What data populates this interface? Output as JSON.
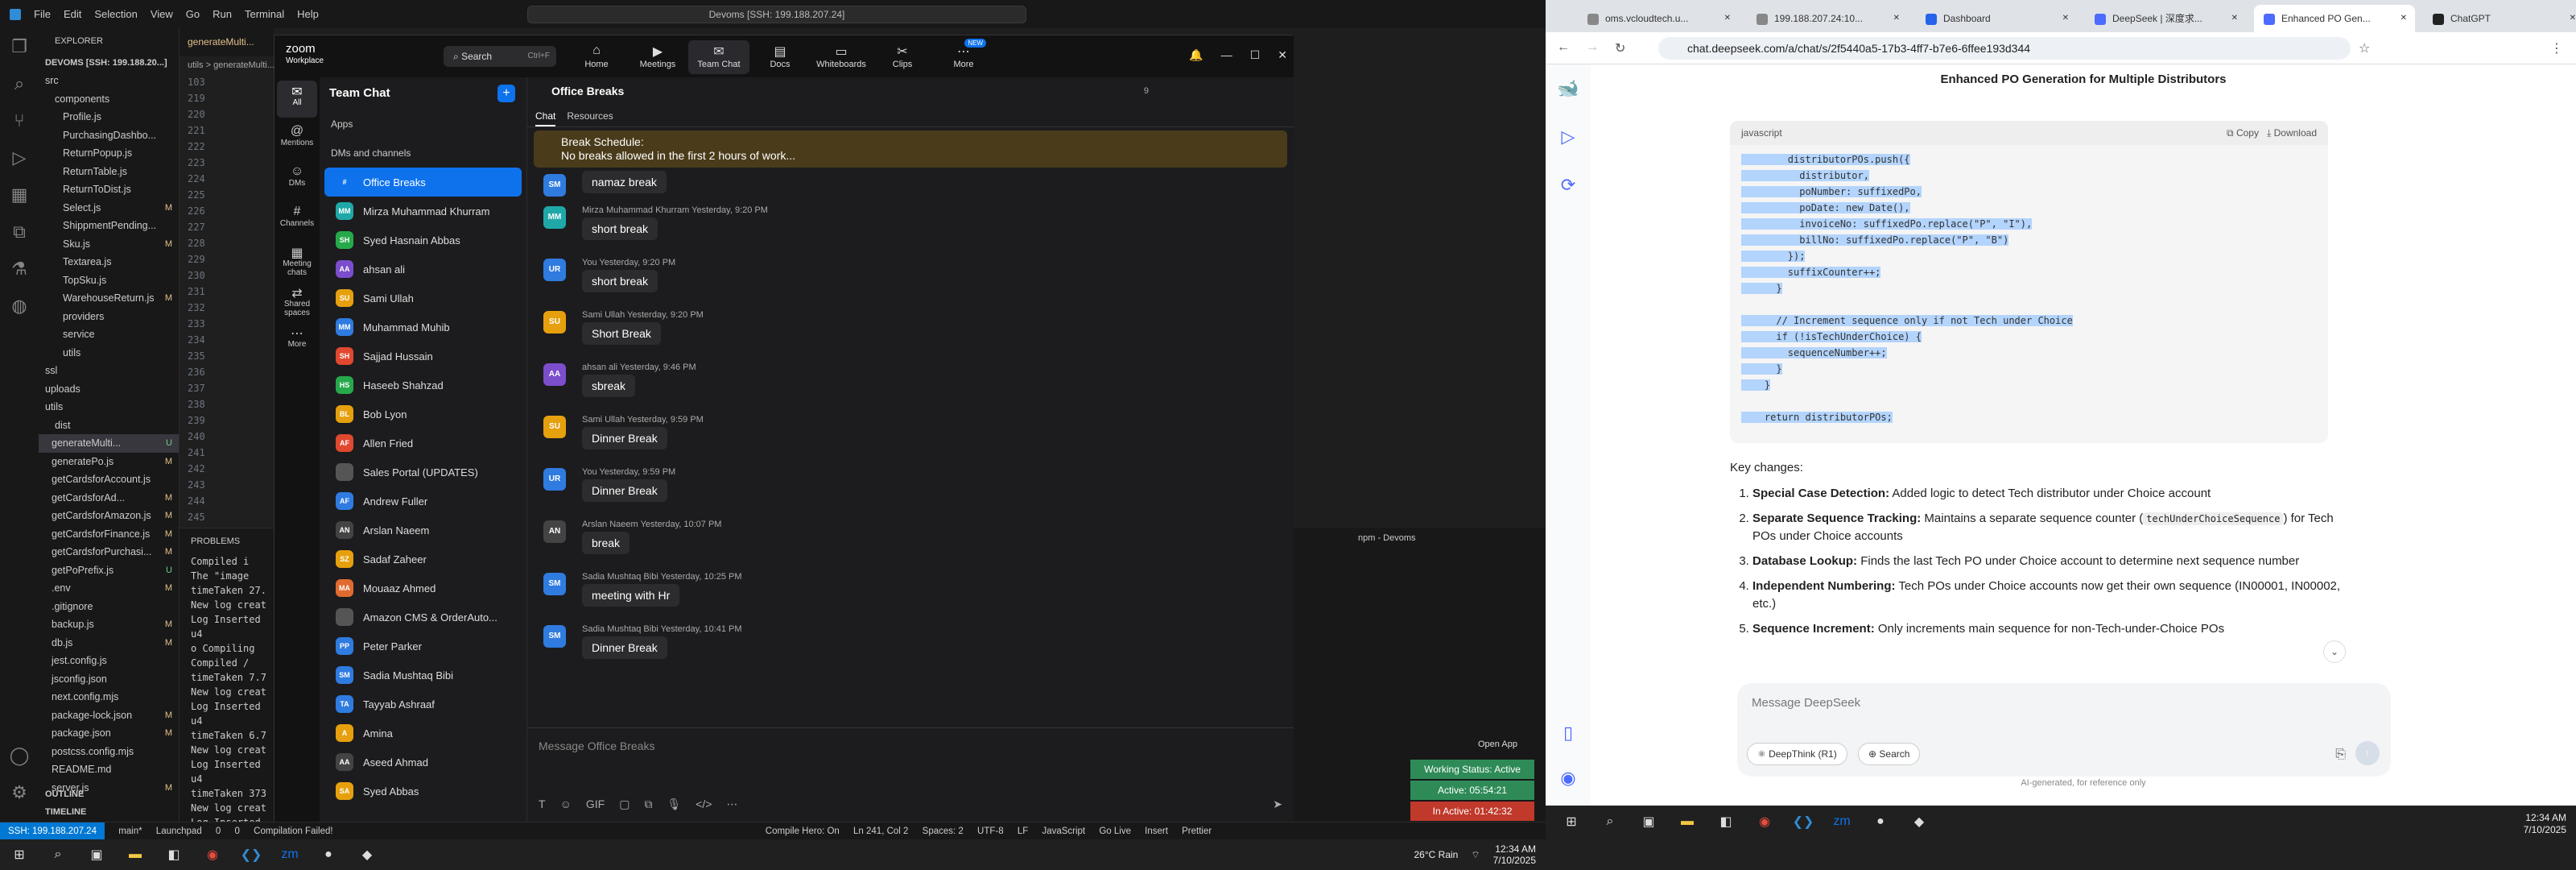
{
  "vscode": {
    "menu": [
      "File",
      "Edit",
      "Selection",
      "View",
      "Go",
      "Run",
      "Terminal",
      "Help"
    ],
    "command_center": "Devoms [SSH: 199.188.207.24]",
    "explorer_title": "EXPLORER",
    "workspace": "DEVOMS [SSH: 199.188.20...]",
    "tab": "generateMulti...",
    "breadcrumb": "utils > generateMulti...",
    "files": [
      {
        "name": "src",
        "s": ""
      },
      {
        "name": "components",
        "s": ""
      },
      {
        "name": "Profile.js",
        "s": ""
      },
      {
        "name": "PurchasingDashbo...",
        "s": ""
      },
      {
        "name": "ReturnPopup.js",
        "s": ""
      },
      {
        "name": "ReturnTable.js",
        "s": ""
      },
      {
        "name": "ReturnToDist.js",
        "s": ""
      },
      {
        "name": "Select.js",
        "s": "M"
      },
      {
        "name": "ShippmentPending...",
        "s": ""
      },
      {
        "name": "Sku.js",
        "s": "M"
      },
      {
        "name": "Textarea.js",
        "s": ""
      },
      {
        "name": "TopSku.js",
        "s": ""
      },
      {
        "name": "WarehouseReturn.js",
        "s": "M"
      },
      {
        "name": "providers",
        "s": ""
      },
      {
        "name": "service",
        "s": ""
      },
      {
        "name": "utils",
        "s": ""
      },
      {
        "name": "ssl",
        "s": ""
      },
      {
        "name": "uploads",
        "s": ""
      },
      {
        "name": "utils",
        "s": ""
      },
      {
        "name": "dist",
        "s": ""
      },
      {
        "name": "generateMulti...",
        "s": "U"
      },
      {
        "name": "generatePo.js",
        "s": "M"
      },
      {
        "name": "getCardsforAccount.js",
        "s": ""
      },
      {
        "name": "getCardsforAd...",
        "s": "M"
      },
      {
        "name": "getCardsforAmazon.js",
        "s": "M"
      },
      {
        "name": "getCardsforFinance.js",
        "s": "M"
      },
      {
        "name": "getCardsforPurchasi...",
        "s": "M"
      },
      {
        "name": "getPoPrefix.js",
        "s": "U"
      },
      {
        "name": ".env",
        "s": "M"
      },
      {
        "name": ".gitignore",
        "s": ""
      },
      {
        "name": "backup.js",
        "s": "M"
      },
      {
        "name": "db.js",
        "s": "M"
      },
      {
        "name": "jest.config.js",
        "s": ""
      },
      {
        "name": "jsconfig.json",
        "s": ""
      },
      {
        "name": "next.config.mjs",
        "s": ""
      },
      {
        "name": "package-lock.json",
        "s": "M"
      },
      {
        "name": "package.json",
        "s": "M"
      },
      {
        "name": "postcss.config.mjs",
        "s": ""
      },
      {
        "name": "README.md",
        "s": ""
      },
      {
        "name": "server.js",
        "s": "M"
      }
    ],
    "outline": "OUTLINE",
    "timeline": "TIMELINE",
    "line_numbers": [
      "103",
      "219",
      "220",
      "221",
      "222",
      "223",
      "224",
      "225",
      "226",
      "227",
      "228",
      "229",
      "230",
      "231",
      "232",
      "233",
      "234",
      "235",
      "236",
      "237",
      "238",
      "239",
      "240",
      "241",
      "242",
      "243",
      "244",
      "245"
    ],
    "problems": "PROBLEMS",
    "terminal_lines": [
      "Compiled i",
      "The \"image",
      "timeTaken 27.",
      "New log creat",
      "Log Inserted",
      "u4",
      "o Compiling",
      "Compiled /",
      "timeTaken 7.7",
      "New log creat",
      "Log Inserted",
      "u4",
      "timeTaken 6.7",
      "New log creat",
      "Log Inserted",
      "u4",
      "timeTaken 373",
      "New log creat",
      "Log Inserted"
    ],
    "term_title": "npm - Devoms",
    "status": {
      "remote": "SSH: 199.188.207.24",
      "branch": "main*",
      "launchpad": "Launchpad",
      "errors": "0",
      "warnings": "0",
      "compile": "Compilation Failed!",
      "hero": "Compile Hero: On",
      "pos": "Ln 241, Col 2",
      "spaces": "Spaces: 2",
      "enc": "UTF-8",
      "eol": "LF",
      "lang": "JavaScript",
      "golive": "Go Live",
      "insert": "Insert",
      "prettier": "Prettier"
    },
    "weather": "26°C Rain",
    "time": "12:34 AM",
    "date": "7/10/2025"
  },
  "zoom": {
    "brand": "zoom",
    "product": "Workplace",
    "search": "Search",
    "search_hint": "Ctrl+F",
    "nav": [
      {
        "label": "Home",
        "icon": "home-icon"
      },
      {
        "label": "Meetings",
        "icon": "video-icon"
      },
      {
        "label": "Team Chat",
        "icon": "chat-icon"
      },
      {
        "label": "Docs",
        "icon": "doc-icon"
      },
      {
        "label": "Whiteboards",
        "icon": "whiteboard-icon"
      },
      {
        "label": "Clips",
        "icon": "clips-icon"
      },
      {
        "label": "More",
        "icon": "more-icon"
      }
    ],
    "new_badge": "NEW",
    "rail": [
      {
        "label": "All",
        "icon": "chat-icon"
      },
      {
        "label": "Mentions",
        "icon": "at-icon"
      },
      {
        "label": "DMs",
        "icon": "person-icon"
      },
      {
        "label": "Channels",
        "icon": "hash-icon"
      },
      {
        "label": "Meeting chats",
        "icon": "calendar-icon"
      },
      {
        "label": "Shared spaces",
        "icon": "share-icon"
      },
      {
        "label": "More",
        "icon": "more-icon"
      }
    ],
    "panel_title": "Team Chat",
    "apps": "Apps",
    "dms_header": "DMs and channels",
    "contacts": [
      {
        "name": "Office Breaks",
        "init": "",
        "color": "#0e72ed"
      },
      {
        "name": "Mirza Muhammad Khurram",
        "init": "MM",
        "color": "#1fa8a8"
      },
      {
        "name": "Syed Hasnain Abbas",
        "init": "SH",
        "color": "#27a94b"
      },
      {
        "name": "ahsan ali",
        "init": "AA",
        "color": "#7c4dcc"
      },
      {
        "name": "Sami Ullah",
        "init": "SU",
        "color": "#e6a00e"
      },
      {
        "name": "Muhammad Muhib",
        "init": "MM",
        "color": "#2f7be0"
      },
      {
        "name": "Sajjad Hussain",
        "init": "SH",
        "color": "#e0482f"
      },
      {
        "name": "Haseeb Shahzad",
        "init": "HS",
        "color": "#27a94b"
      },
      {
        "name": "Bob Lyon",
        "init": "BL",
        "color": "#e6a00e"
      },
      {
        "name": "Allen Fried",
        "init": "AF",
        "color": "#e0482f"
      },
      {
        "name": "Sales Portal (UPDATES)",
        "init": "",
        "color": "#555"
      },
      {
        "name": "Andrew Fuller",
        "init": "AF",
        "color": "#2f7be0"
      },
      {
        "name": "Arslan Naeem",
        "init": "AN",
        "color": "#444"
      },
      {
        "name": "Sadaf Zaheer",
        "init": "SZ",
        "color": "#e6a00e"
      },
      {
        "name": "Mouaaz Ahmed",
        "init": "MA",
        "color": "#e06a2f"
      },
      {
        "name": "Amazon CMS & OrderAuto...",
        "init": "",
        "color": "#555"
      },
      {
        "name": "Peter Parker",
        "init": "PP",
        "color": "#2f7be0"
      },
      {
        "name": "Sadia Mushtaq Bibi",
        "init": "SM",
        "color": "#2f7be0"
      },
      {
        "name": "Tayyab Ashraaf",
        "init": "TA",
        "color": "#2f7be0"
      },
      {
        "name": "Amina",
        "init": "A",
        "color": "#e6a00e"
      },
      {
        "name": "Aseed Ahmad",
        "init": "AA",
        "color": "#444"
      },
      {
        "name": "Syed Abbas",
        "init": "SA",
        "color": "#e6a00e"
      }
    ],
    "channel": "Office Breaks",
    "member_count": "9",
    "tabs": [
      "Chat",
      "Resources"
    ],
    "banner_title": "Break Schedule:",
    "banner_text": "No breaks allowed in the first 2 hours of work...",
    "messages": [
      {
        "sender": "",
        "time": "",
        "text": "namaz break",
        "init": "SM",
        "color": "#2f7be0"
      },
      {
        "sender": "Mirza Muhammad Khurram",
        "time": "Yesterday, 9:20 PM",
        "text": "short break",
        "init": "MM",
        "color": "#1fa8a8"
      },
      {
        "sender": "You",
        "time": "Yesterday, 9:20 PM",
        "text": "short break",
        "init": "UR",
        "color": "#2f7be0"
      },
      {
        "sender": "Sami Ullah",
        "time": "Yesterday, 9:20 PM",
        "text": "Short Break",
        "init": "SU",
        "color": "#e6a00e"
      },
      {
        "sender": "ahsan ali",
        "time": "Yesterday, 9:46 PM",
        "text": "sbreak",
        "init": "AA",
        "color": "#7c4dcc"
      },
      {
        "sender": "Sami Ullah",
        "time": "Yesterday, 9:59 PM",
        "text": "Dinner Break",
        "init": "SU",
        "color": "#e6a00e"
      },
      {
        "sender": "You",
        "time": "Yesterday, 9:59 PM",
        "text": "Dinner Break",
        "init": "UR",
        "color": "#2f7be0"
      },
      {
        "sender": "Arslan Naeem",
        "time": "Yesterday, 10:07 PM",
        "text": "break",
        "init": "AN",
        "color": "#444"
      },
      {
        "sender": "Sadia Mushtaq Bibi",
        "time": "Yesterday, 10:25 PM",
        "text": "meeting with Hr",
        "init": "SM",
        "color": "#2f7be0"
      },
      {
        "sender": "Sadia Mushtaq Bibi",
        "time": "Yesterday, 10:41 PM",
        "text": "Dinner Break",
        "init": "SM",
        "color": "#2f7be0"
      }
    ],
    "input_placeholder": "Message Office Breaks",
    "open_app": "Open App",
    "working_status": "Working Status: Active",
    "active": "Active: 05:54:21",
    "inactive": "In Active: 01:42:32"
  },
  "chrome": {
    "tabs": [
      "oms.vcloudtech.u...",
      "199.188.207.24:10...",
      "Dashboard",
      "DeepSeek | 深度求...",
      "Enhanced PO Gen...",
      "ChatGPT"
    ],
    "url": "chat.deepseek.com/a/chat/s/2f5440a5-17b3-4ff7-b7e6-6ffee193d344"
  },
  "deepseek": {
    "title": "Enhanced PO Generation for Multiple Distributors",
    "code_lang": "javascript",
    "copy": "Copy",
    "download": "Download",
    "code_lines": [
      "        distributorPOs.push({",
      "          distributor,",
      "          poNumber: suffixedPo,",
      "          poDate: new Date(),",
      "          invoiceNo: suffixedPo.replace(\"P\", \"I\"),",
      "          billNo: suffixedPo.replace(\"P\", \"B\")",
      "        });",
      "        suffixCounter++;",
      "      }",
      "",
      "      // Increment sequence only if not Tech under Choice",
      "      if (!isTechUnderChoice) {",
      "        sequenceNumber++;",
      "      }",
      "    }",
      "",
      "    return distributorPOs;"
    ],
    "key_title": "Key changes:",
    "changes": [
      {
        "b": "Special Case Detection:",
        "t": " Added logic to detect Tech distributor under Choice account"
      },
      {
        "b": "Separate Sequence Tracking:",
        "t": " Maintains a separate sequence counter (",
        "code": "techUnderChoiceSequence",
        "t2": ") for Tech POs under Choice accounts"
      },
      {
        "b": "Database Lookup:",
        "t": " Finds the last Tech PO under Choice account to determine next sequence number"
      },
      {
        "b": "Independent Numbering:",
        "t": " Tech POs under Choice accounts now get their own sequence (IN00001, IN00002, etc.)"
      },
      {
        "b": "Sequence Increment:",
        "t": " Only increments main sequence for non-Tech-under-Choice POs"
      }
    ],
    "input_placeholder": "Message DeepSeek",
    "deepthink": "DeepThink (R1)",
    "search": "Search",
    "disclaimer": "AI-generated, for reference only"
  },
  "taskbar_right": {
    "time": "12:34 AM",
    "date": "7/10/2025"
  }
}
